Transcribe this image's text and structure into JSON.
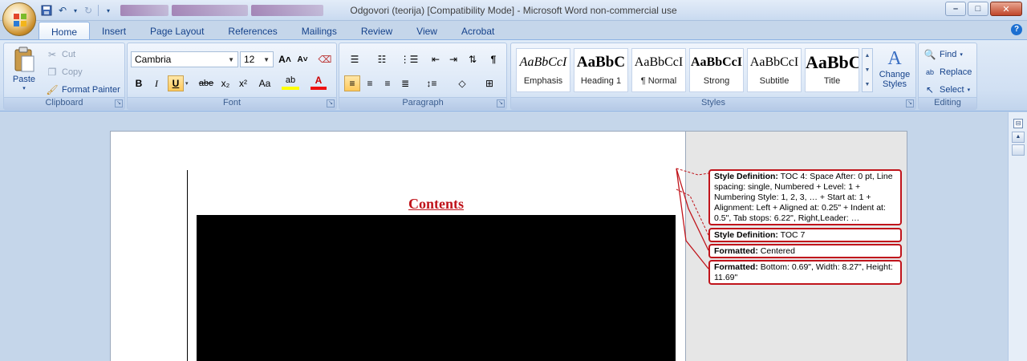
{
  "window": {
    "title": "Odgovori (teorija) [Compatibility Mode] - Microsoft Word non-commercial use",
    "minimize": "–",
    "maximize": "□",
    "close": "✕"
  },
  "tabs": [
    "Home",
    "Insert",
    "Page Layout",
    "References",
    "Mailings",
    "Review",
    "View",
    "Acrobat"
  ],
  "clipboard": {
    "paste": "Paste",
    "cut": "Cut",
    "copy": "Copy",
    "format_painter": "Format Painter",
    "label": "Clipboard"
  },
  "font": {
    "name": "Cambria",
    "size": "12",
    "label": "Font",
    "grow": "A˄",
    "shrink": "A˅",
    "bold": "B",
    "italic": "I",
    "underline": "U",
    "strike": "abe",
    "subscript": "x₂",
    "superscript": "x²",
    "change_case": "Aa",
    "highlight": "ab",
    "font_color": "A"
  },
  "paragraph": {
    "label": "Paragraph",
    "pilcrow": "¶"
  },
  "styles": {
    "label": "Styles",
    "change_styles": [
      "Change",
      "Styles"
    ],
    "items": [
      {
        "sample": "AaBbCcI",
        "name": "Emphasis"
      },
      {
        "sample": "AaBbC",
        "name": "Heading 1"
      },
      {
        "sample": "AaBbCcI",
        "name": "¶ Normal"
      },
      {
        "sample": "AaBbCcI",
        "name": "Strong"
      },
      {
        "sample": "AaBbCcI",
        "name": "Subtitle"
      },
      {
        "sample": "AaBbC",
        "name": "Title"
      }
    ]
  },
  "editing": {
    "label": "Editing",
    "find": "Find",
    "replace": "Replace",
    "select": "Select"
  },
  "document": {
    "heading": "Contents",
    "balloons": [
      {
        "title": "Style Definition:",
        "text": "TOC 4: Space After:  0 pt, Line spacing:  single, Numbered + Level: 1 + Numbering Style: 1, 2, 3, … + Start at: 1 + Alignment: Left + Aligned at:  0.25\" + Indent at:  0.5\", Tab stops:  6.22\", Right,Leader: …"
      },
      {
        "title": "Style Definition:",
        "text": "TOC 7"
      },
      {
        "title": "Formatted:",
        "text": "Centered"
      },
      {
        "title": "Formatted:",
        "text": "Bottom:  0.69\", Width:  8.27\", Height:  11.69\""
      }
    ]
  },
  "help": "?"
}
